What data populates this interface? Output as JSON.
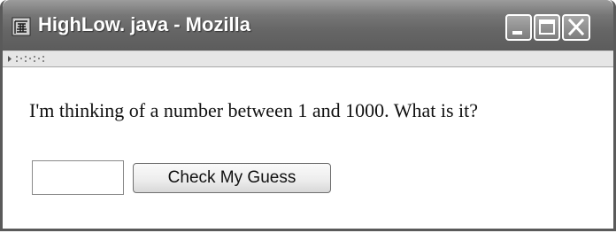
{
  "window": {
    "title": "HighLow. java - Mozilla",
    "controls": [
      "minimize-icon",
      "maximize-icon",
      "close-icon"
    ]
  },
  "page": {
    "prompt": "I'm thinking of a number between 1 and 1000. What is it?",
    "guess_input": {
      "value": "",
      "placeholder": ""
    },
    "check_button_label": "Check My Guess"
  },
  "colors": {
    "titlebar": "#6a6a6a",
    "title_text": "#ffffff",
    "page_background": "#ffffff"
  }
}
